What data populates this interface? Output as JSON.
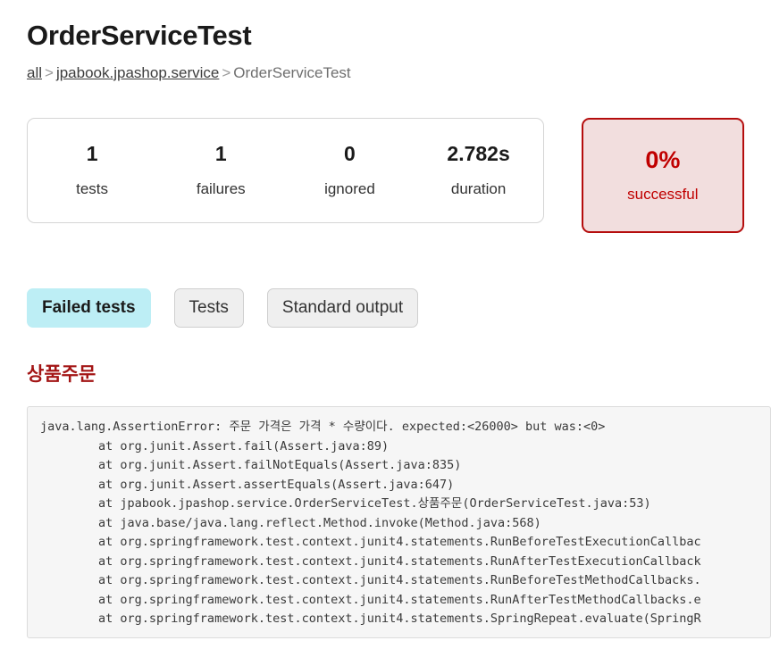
{
  "header": {
    "title": "OrderServiceTest",
    "breadcrumb": {
      "root": "all",
      "package": "jpabook.jpashop.service",
      "current": "OrderServiceTest",
      "separator": ">"
    }
  },
  "summary": {
    "stats": [
      {
        "value": "1",
        "label": "tests"
      },
      {
        "value": "1",
        "label": "failures"
      },
      {
        "value": "0",
        "label": "ignored"
      },
      {
        "value": "2.782s",
        "label": "duration"
      }
    ],
    "success_rate": {
      "value": "0%",
      "label": "successful",
      "border_color": "#b50d0d",
      "background_color": "#f2dede",
      "text_color": "#c00000"
    }
  },
  "tabs": [
    {
      "label": "Failed tests",
      "active": true
    },
    {
      "label": "Tests",
      "active": false
    },
    {
      "label": "Standard output",
      "active": false
    }
  ],
  "failure": {
    "test_name": "상품주문",
    "stack_trace": "java.lang.AssertionError: 주문 가격은 가격 * 수량이다. expected:<26000> but was:<0>\n        at org.junit.Assert.fail(Assert.java:89)\n        at org.junit.Assert.failNotEquals(Assert.java:835)\n        at org.junit.Assert.assertEquals(Assert.java:647)\n        at jpabook.jpashop.service.OrderServiceTest.상품주문(OrderServiceTest.java:53)\n        at java.base/java.lang.reflect.Method.invoke(Method.java:568)\n        at org.springframework.test.context.junit4.statements.RunBeforeTestExecutionCallbac\n        at org.springframework.test.context.junit4.statements.RunAfterTestExecutionCallback\n        at org.springframework.test.context.junit4.statements.RunBeforeTestMethodCallbacks.\n        at org.springframework.test.context.junit4.statements.RunAfterTestMethodCallbacks.e\n        at org.springframework.test.context.junit4.statements.SpringRepeat.evaluate(SpringR"
  }
}
